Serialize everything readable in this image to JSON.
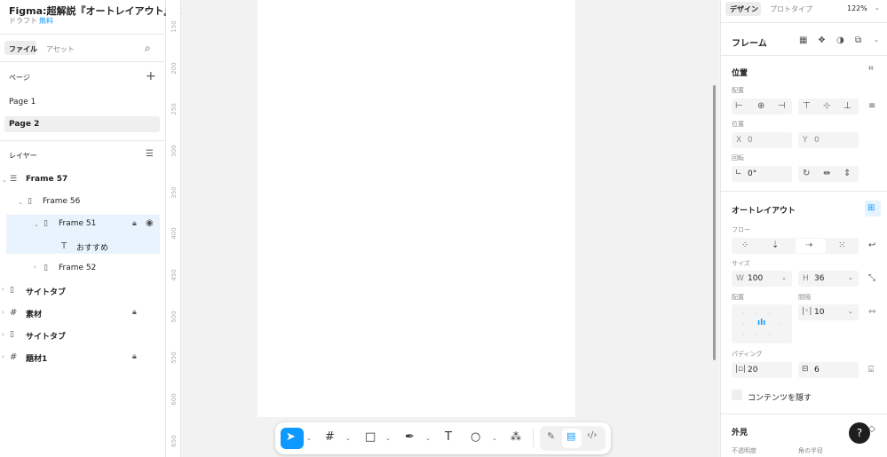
{
  "file": {
    "title": "Figma:超解説『オートレイアウト』...",
    "status": "ドラフト",
    "plan": "無料"
  },
  "left_tabs": {
    "file": "ファイル",
    "assets": "アセット"
  },
  "pages": {
    "heading": "ページ",
    "items": [
      "Page 1",
      "Page 2"
    ]
  },
  "layers": {
    "heading": "レイヤー",
    "items": [
      "Frame 57",
      "Frame 56",
      "Frame 51",
      "おすすめ",
      "Frame 52",
      "サイトタブ",
      "素材",
      "サイトタブ",
      "題材1"
    ]
  },
  "ruler": {
    "ticks": [
      "150",
      "200",
      "250",
      "300",
      "350",
      "400",
      "450",
      "500",
      "550",
      "600",
      "650"
    ]
  },
  "right_tabs": {
    "design": "デザイン",
    "prototype": "プロトタイプ",
    "zoom": "122%"
  },
  "frame_section": {
    "label": "フレーム"
  },
  "position": {
    "heading": "位置",
    "align_label": "配置",
    "pos_label": "位置",
    "x_label": "X",
    "x_value": "0",
    "y_label": "Y",
    "y_value": "0",
    "rotation_label": "回転",
    "rotation_value": "0°"
  },
  "autolayout": {
    "heading": "オートレイアウト",
    "flow_label": "フロー",
    "size_label": "サイズ",
    "w_label": "W",
    "w_value": "100",
    "h_label": "H",
    "h_value": "36",
    "align_label": "配置",
    "gap_label": "間隔",
    "gap_value": "10",
    "padding_label": "パディング",
    "pad_h": "20",
    "pad_v": "6",
    "clip_label": "コンテンツを隠す"
  },
  "appearance": {
    "heading": "外見",
    "opacity_label": "不透明度",
    "radius_label": "角の半径"
  },
  "help": "?",
  "colors": {
    "accent": "#0d99ff",
    "selection": "#e9f3fd"
  }
}
